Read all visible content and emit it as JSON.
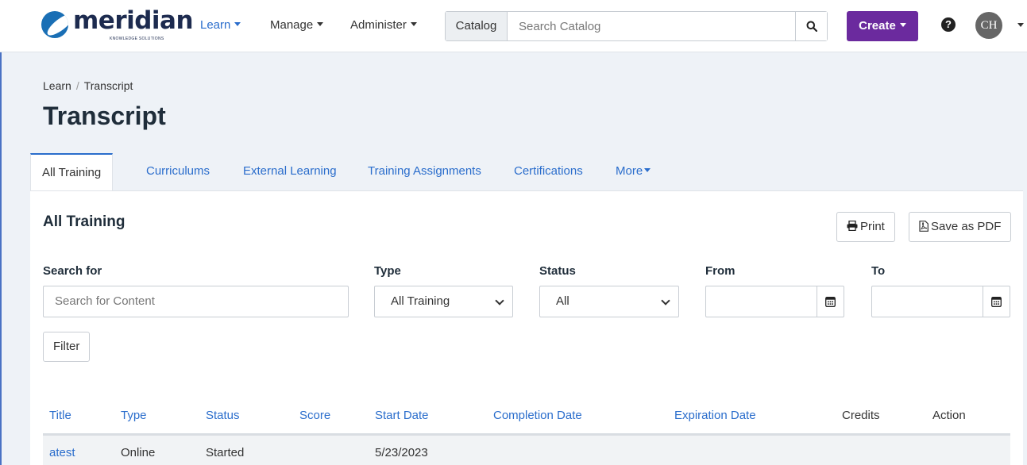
{
  "brand": {
    "name": "meridian",
    "tagline": "KNOWLEDGE SOLUTIONS",
    "color": "#1a6fb5"
  },
  "nav": {
    "items": [
      {
        "label": "Learn",
        "active": true
      },
      {
        "label": "Manage",
        "active": false
      },
      {
        "label": "Administer",
        "active": false
      }
    ],
    "search": {
      "prefix": "Catalog",
      "placeholder": "Search Catalog",
      "icon": "search-icon"
    },
    "create_label": "Create",
    "create_color": "#6b2a9e",
    "help_icon": "question-circle-icon",
    "avatar_initials": "CH"
  },
  "breadcrumb": {
    "parent": "Learn",
    "current": "Transcript",
    "separator": "/"
  },
  "page_title": "Transcript",
  "tabs": [
    {
      "label": "All Training",
      "active": true
    },
    {
      "label": "Curriculums",
      "active": false
    },
    {
      "label": "External Learning",
      "active": false
    },
    {
      "label": "Training Assignments",
      "active": false
    },
    {
      "label": "Certifications",
      "active": false
    },
    {
      "label": "More",
      "active": false
    }
  ],
  "section": {
    "title": "All Training",
    "print_label": "Print",
    "pdf_label": "Save as PDF"
  },
  "filters": {
    "search_label": "Search for",
    "search_placeholder": "Search for Content",
    "type_label": "Type",
    "type_value": "All Training",
    "status_label": "Status",
    "status_value": "All",
    "from_label": "From",
    "from_value": "",
    "to_label": "To",
    "to_value": "",
    "filter_button": "Filter"
  },
  "table": {
    "columns": [
      "Title",
      "Type",
      "Status",
      "Score",
      "Start Date",
      "Completion Date",
      "Expiration Date",
      "Credits",
      "Action"
    ],
    "rows": [
      {
        "title": "atest",
        "type": "Online",
        "status": "Started",
        "score": "",
        "start_date": "5/23/2023",
        "completion_date": "",
        "expiration_date": "",
        "credits": "",
        "action": ""
      }
    ]
  },
  "colors": {
    "link": "#2a6dcc",
    "background": "#eef2f7",
    "panel": "#ffffff"
  }
}
